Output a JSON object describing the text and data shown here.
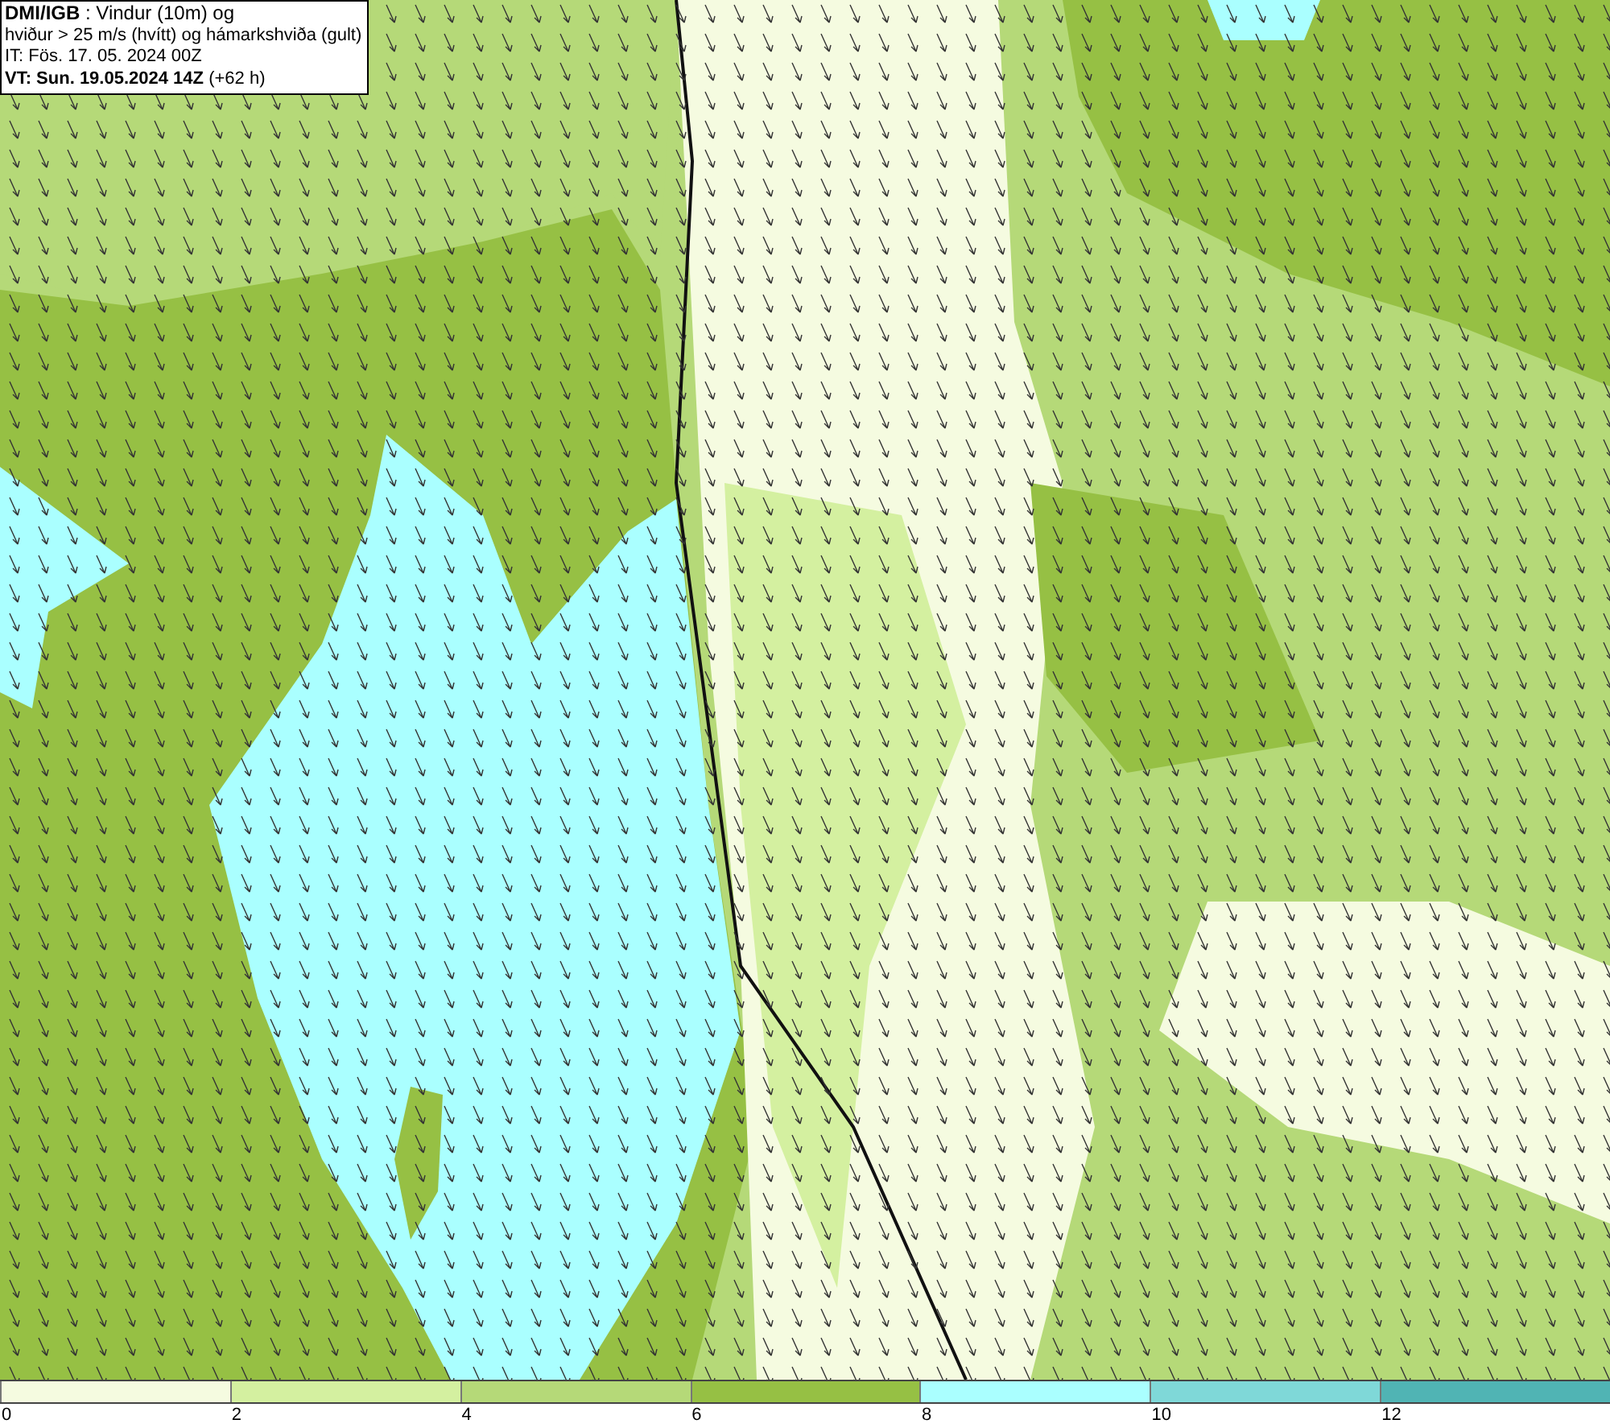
{
  "title_box": {
    "lines": [
      "**DMI/IGB** : Vindur (10m) og",
      "hviður > 25 m/s (hvítt) og hámarkshviða (gult)",
      "IT: Fös. 17. 05. 2024 00Z",
      "**VT: Sun. 19.05.2024 14Z** (+62 h)"
    ]
  },
  "legend": {
    "bins": [
      {
        "color": "#f5fbe0"
      },
      {
        "color": "#d4f0a0"
      },
      {
        "color": "#b5d978"
      },
      {
        "color": "#96c044"
      },
      {
        "color": "#aaffff"
      },
      {
        "color": "#7fd8d8"
      },
      {
        "color": "#50b4b4"
      }
    ],
    "ticks": [
      "0",
      "2",
      "4",
      "6",
      "8",
      "10",
      "12"
    ]
  }
}
